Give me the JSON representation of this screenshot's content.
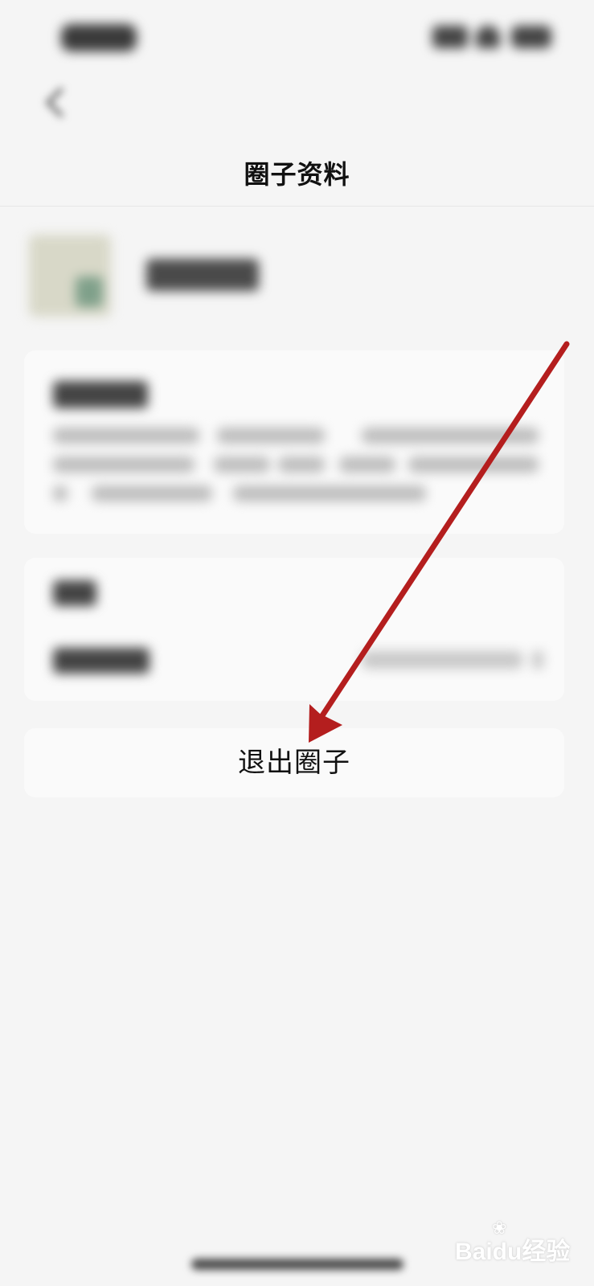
{
  "header": {
    "title": "圈子资料"
  },
  "exit": {
    "label": "退出圈子"
  },
  "watermark": {
    "text": "Baidu经验"
  },
  "colors": {
    "background": "#f5f5f5",
    "card": "#fafafa",
    "annotation_arrow": "#b41e1e"
  },
  "icons": {
    "back": "chevron-left-icon",
    "annotation": "red-arrow"
  }
}
